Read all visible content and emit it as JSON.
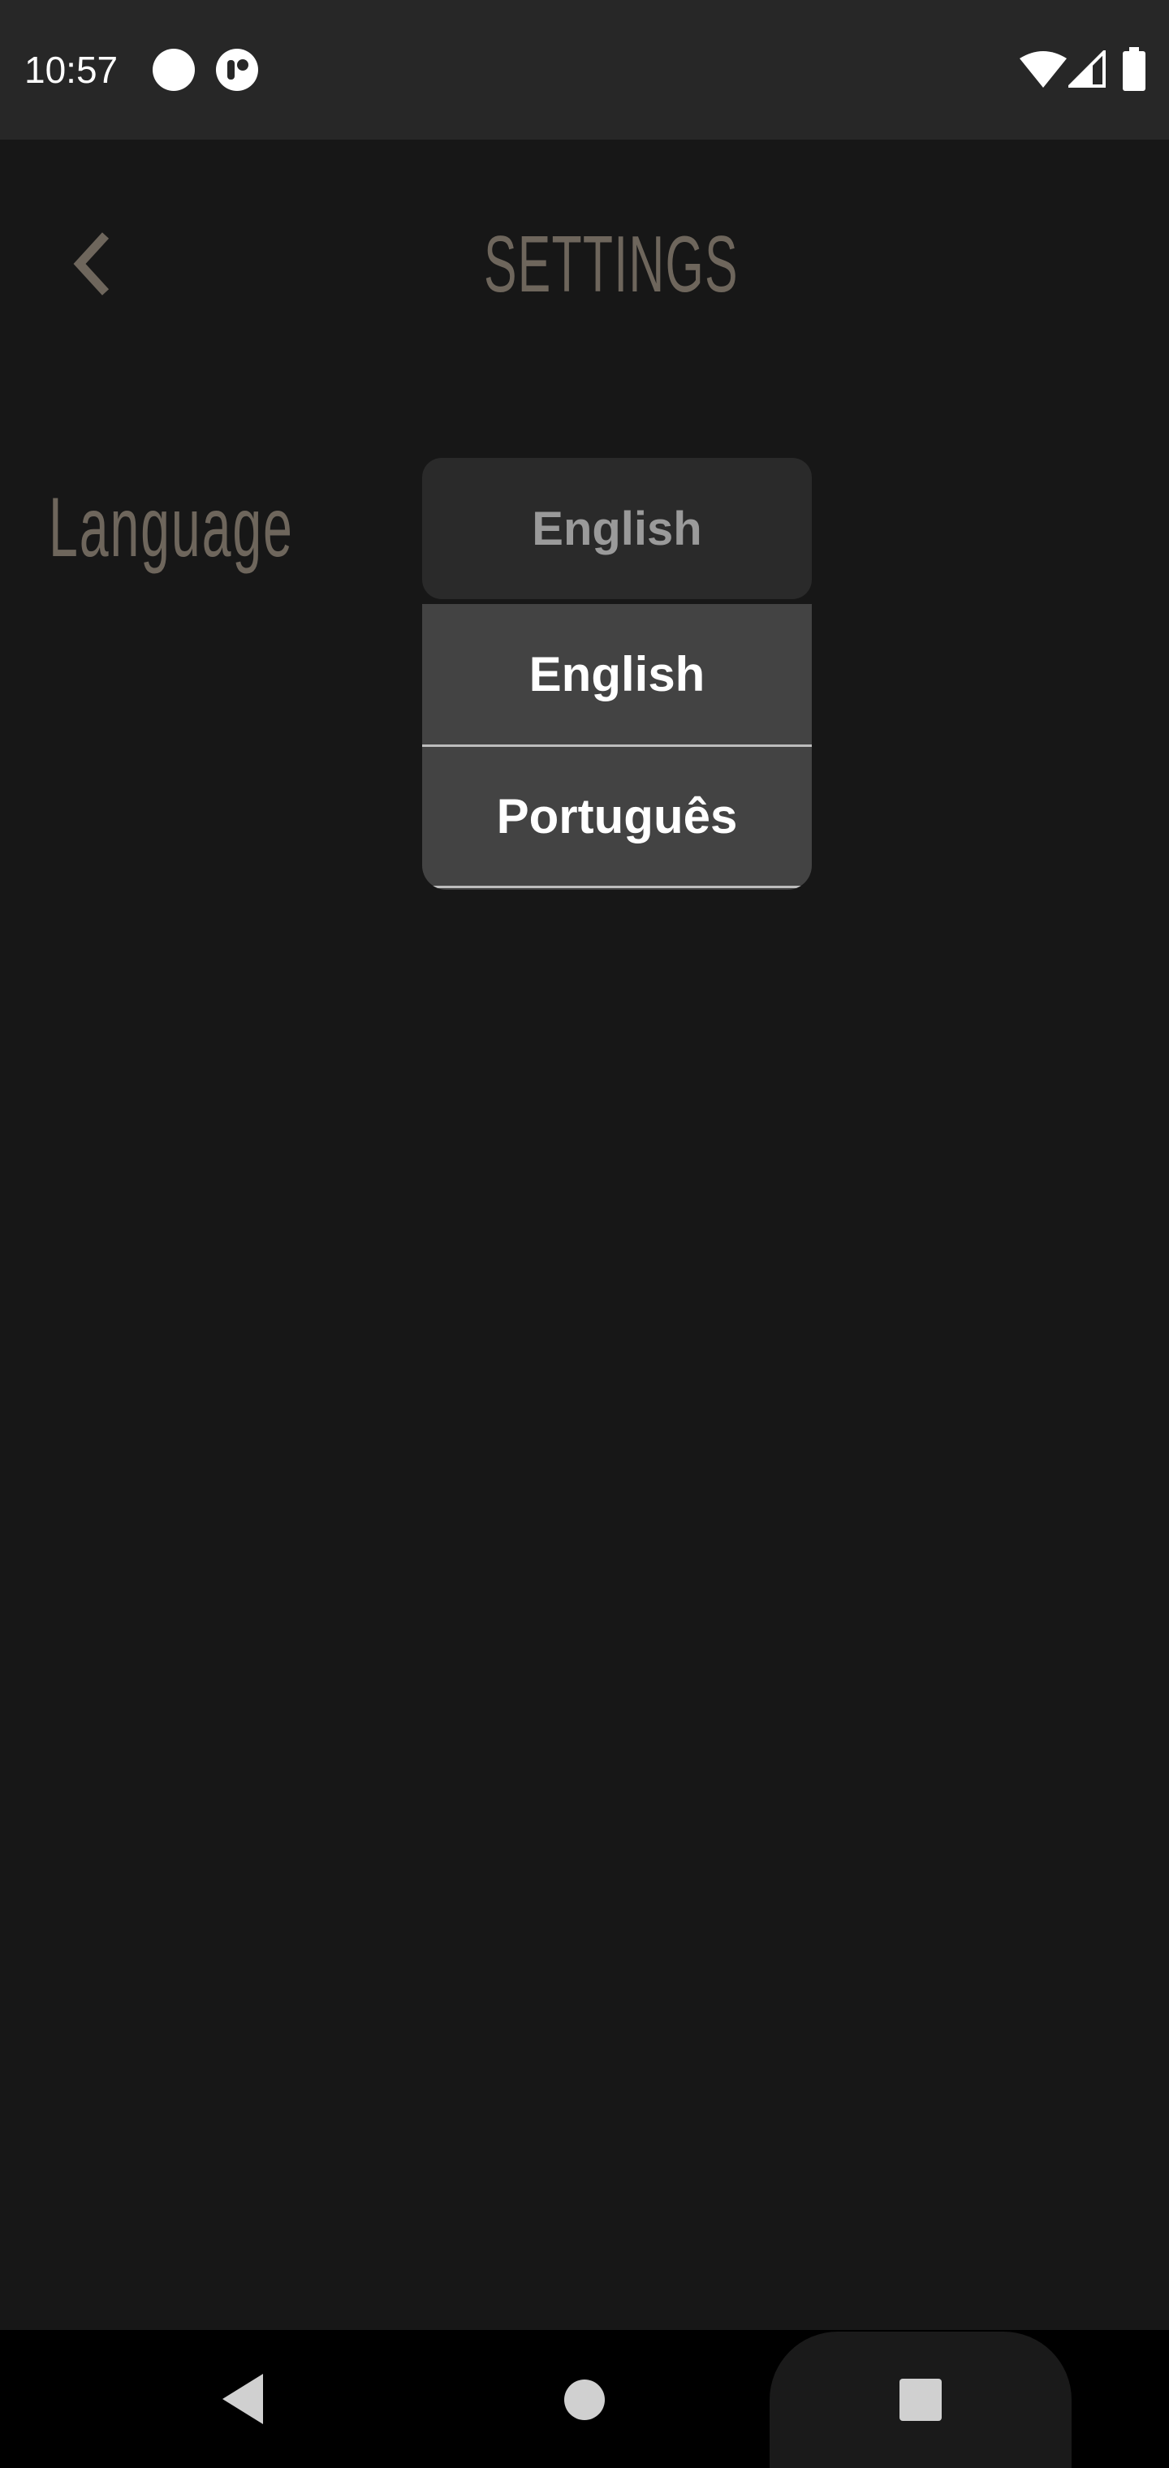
{
  "status_bar": {
    "time": "10:57",
    "icons_left": [
      "circle-notification-icon",
      "app-notification-icon"
    ],
    "icons_right": [
      "wifi-icon",
      "cell-signal-icon",
      "battery-icon"
    ]
  },
  "header": {
    "title": "SETTINGS",
    "back_icon": "chevron-left-icon"
  },
  "settings": {
    "language_label": "Language",
    "language_select": {
      "selected": "English",
      "options": [
        "English",
        "Português"
      ]
    }
  },
  "nav_bar": {
    "buttons": [
      "back-triangle-icon",
      "home-circle-icon",
      "recents-square-icon"
    ]
  },
  "colors": {
    "background": "#171717",
    "status_bar": "#272727",
    "accent_text": "#6e665c",
    "dropdown_bg": "#434343",
    "select_bg": "#2a2a2a"
  }
}
